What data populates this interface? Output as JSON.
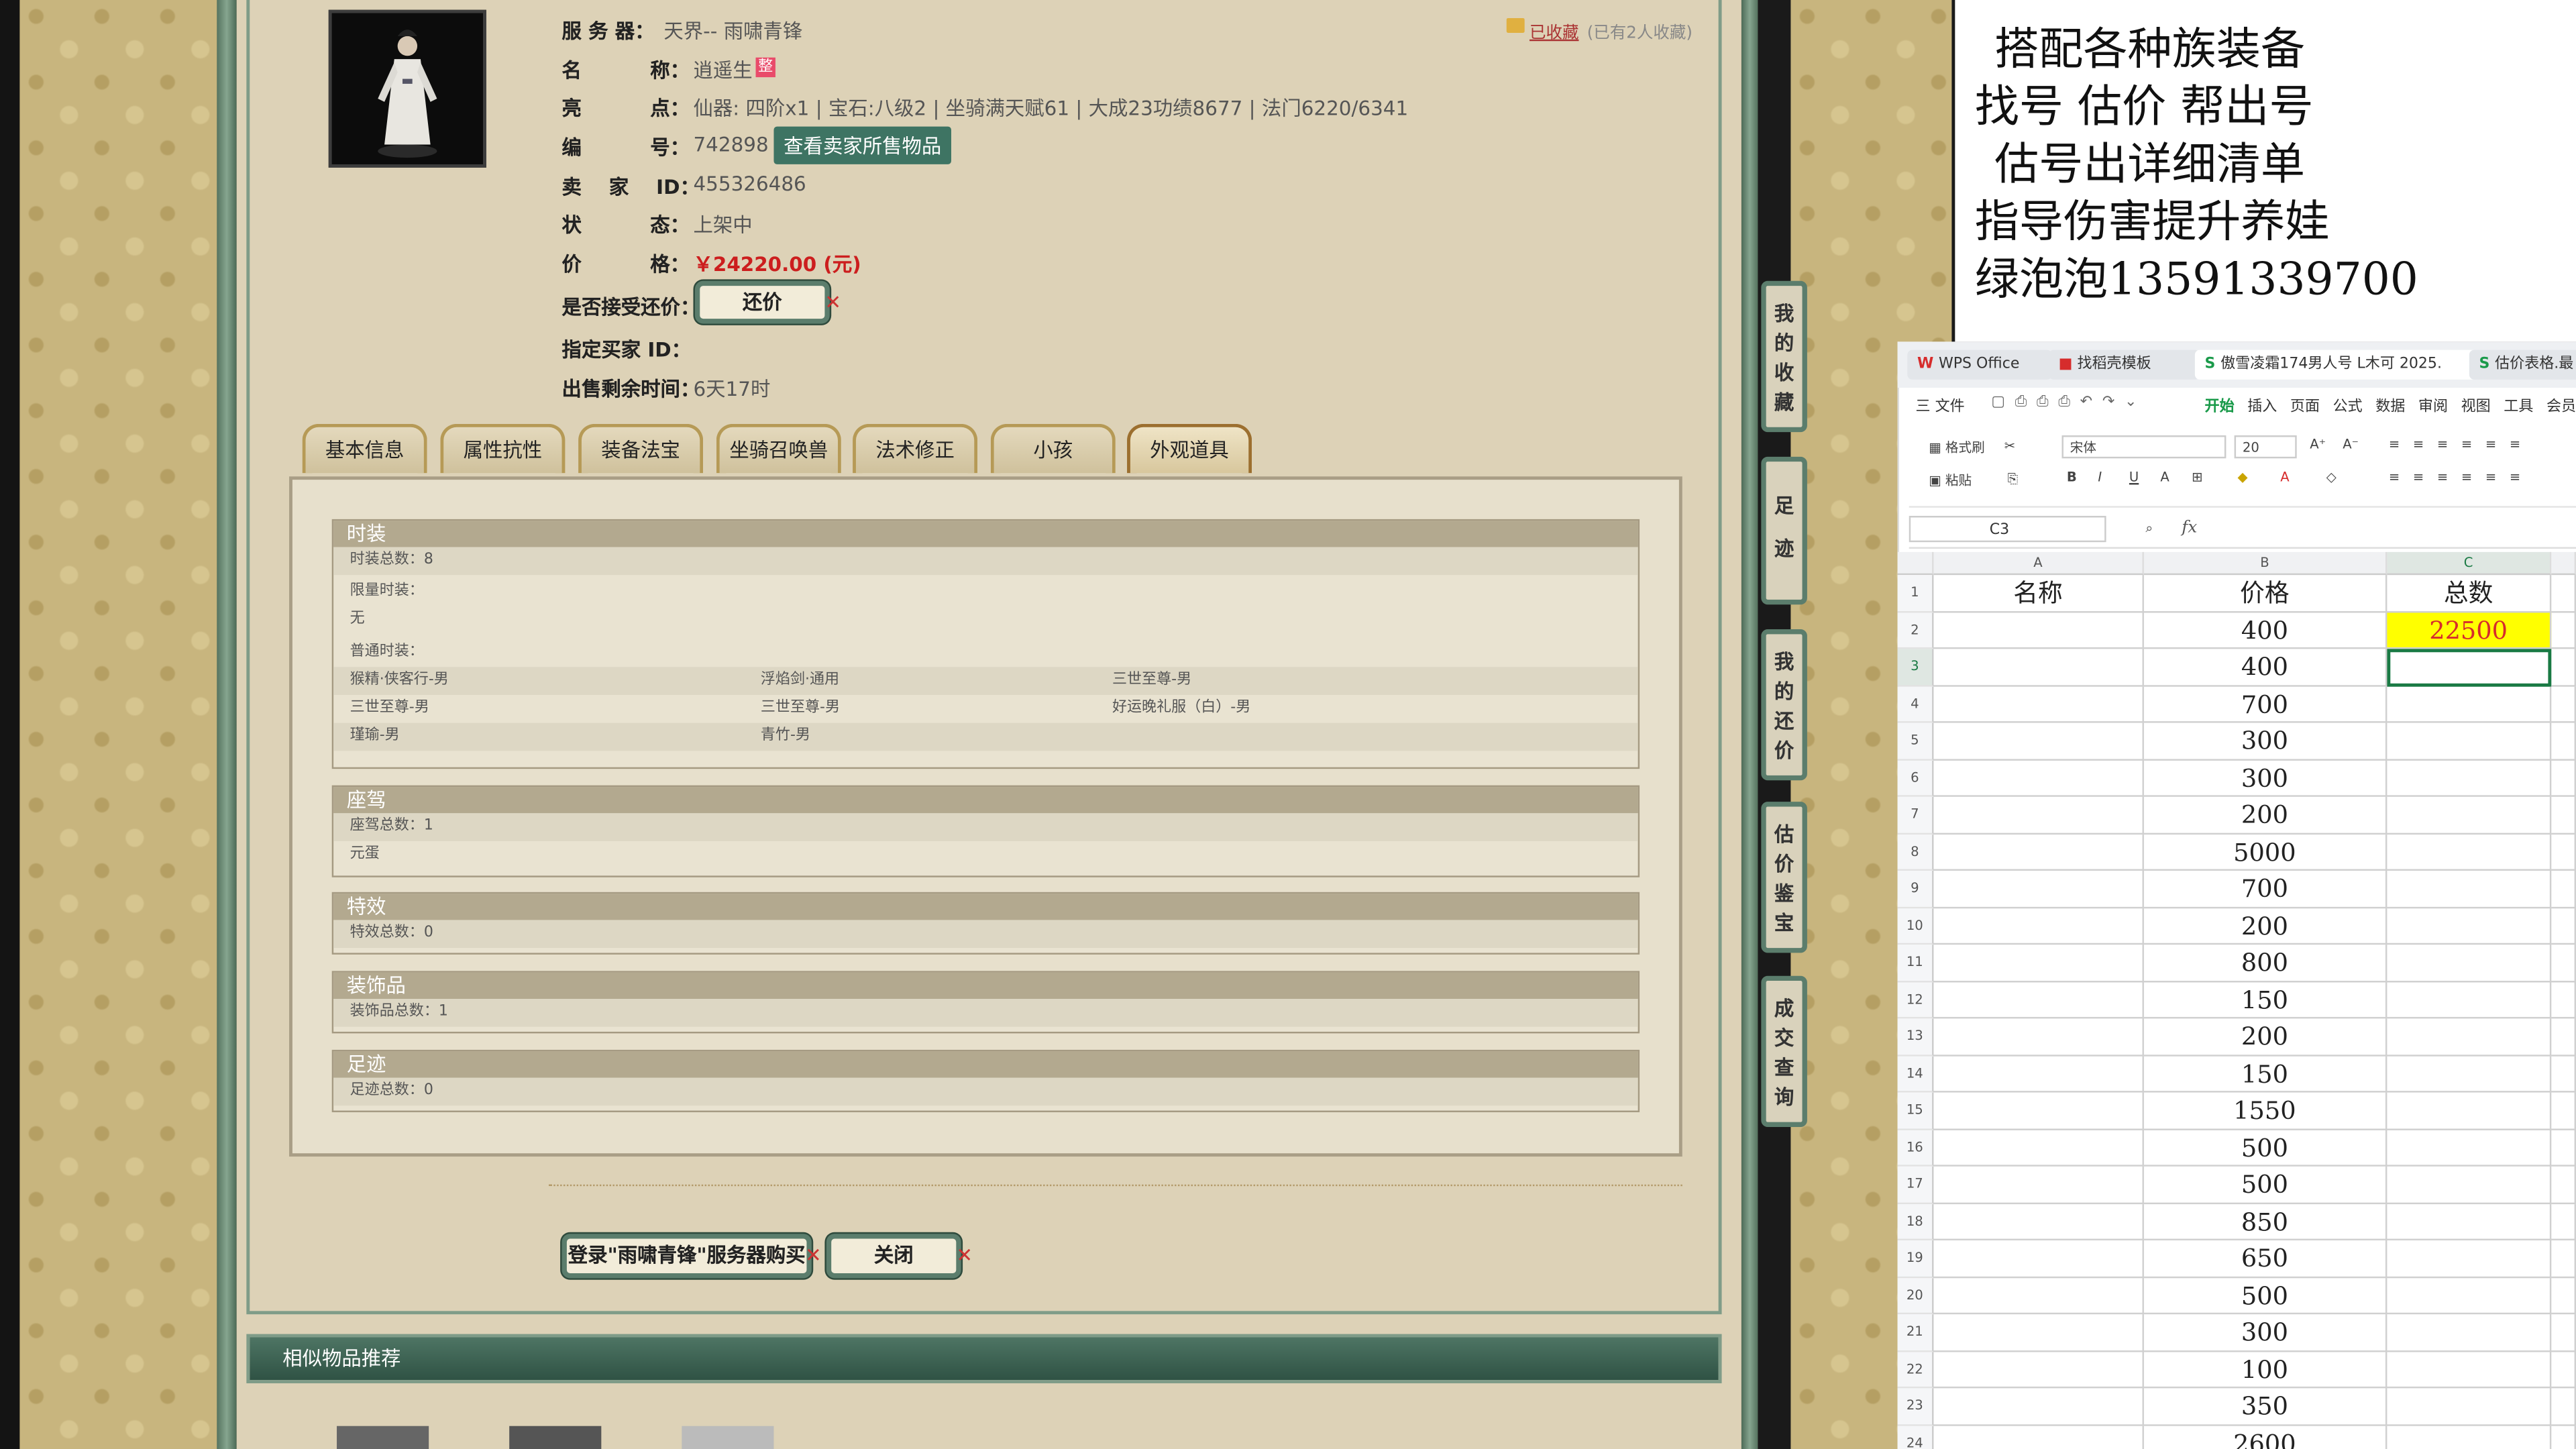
{
  "item": {
    "server_label": "服 务 器：",
    "server_value": "天界-- 雨啸青锋",
    "name_label": "名          称：",
    "name_value": "逍遥生",
    "name_badge": "整",
    "highlights_label": "亮          点：",
    "highlights_value": "仙器: 四阶x1 | 宝石:八级2 | 坐骑满天赋61 | 大成23功绩8677 | 法门6220/6341",
    "id_label": "编          号：",
    "id_value": "742898",
    "view_seller_button": "查看卖家所售物品",
    "seller_label": "卖    家    ID：",
    "seller_value": "455326486",
    "status_label": "状          态：",
    "status_value": "上架中",
    "price_label": "价          格：",
    "price_value": "￥24220.00 (元)",
    "accept_offer_label": "是否接受还价：",
    "offer_button": "还价",
    "buyer_label": "指定买家 ID：",
    "remaining_label": "出售剩余时间：",
    "remaining_value": "6天17时",
    "favorited_text": "已收藏",
    "favorited_count_text": "(已有2人收藏)"
  },
  "tabs": [
    {
      "label": "基本信息",
      "active": false
    },
    {
      "label": "属性抗性",
      "active": false
    },
    {
      "label": "装备法宝",
      "active": false
    },
    {
      "label": "坐骑召唤兽",
      "active": false
    },
    {
      "label": "法术修正",
      "active": false
    },
    {
      "label": "小孩",
      "active": false
    },
    {
      "label": "外观道具",
      "active": true
    }
  ],
  "sections": {
    "fashion": {
      "title": "时装",
      "total": "时装总数：8",
      "limited_label": "限量时装：",
      "limited_value": "无",
      "normal_label": "普通时装：",
      "rows": [
        [
          "猴精·侠客行-男",
          "浮焰剑·通用",
          "三世至尊-男"
        ],
        [
          "三世至尊-男",
          "三世至尊-男",
          "好运晚礼服（白）-男"
        ],
        [
          "瑾瑜-男",
          "青竹-男",
          ""
        ]
      ]
    },
    "mount": {
      "title": "座驾",
      "total": "座驾总数：1",
      "item": "元蛋"
    },
    "effect": {
      "title": "特效",
      "total": "特效总数：0"
    },
    "decoration": {
      "title": "装饰品",
      "total": "装饰品总数：1"
    },
    "footprint": {
      "title": "足迹",
      "total": "足迹总数：0"
    }
  },
  "actions": {
    "login_buy": "登录\"雨啸青锋\"服务器购买",
    "close": "关闭"
  },
  "similar_title": "相似物品推荐",
  "side_nav": [
    "我的收藏",
    "足迹",
    "我的还价",
    "估价鉴宝",
    "成交查询"
  ],
  "ad": {
    "lines": [
      "搭配各种族装备",
      "找号  估价  帮出号",
      "估号出详细清单",
      "指导伤害提升养娃",
      "绿泡泡13591339700"
    ]
  },
  "wps": {
    "tabs": [
      "WPS Office",
      "找稻壳模板",
      "傲雪凌霜174男人号 L木可 2025.",
      "估价表格.最"
    ],
    "menu": [
      "三 文件",
      "开始",
      "插入",
      "页面",
      "公式",
      "数据",
      "审阅",
      "视图",
      "工具",
      "会员"
    ],
    "font_name": "宋体",
    "font_size": "20",
    "format_painter": "格式刷",
    "paste": "粘贴",
    "cell_ref": "C3",
    "fx": "fx",
    "columns": [
      "A",
      "B",
      "C"
    ],
    "headers": [
      "名称",
      "价格",
      "总数"
    ],
    "total": "22500",
    "prices": [
      "400",
      "400",
      "700",
      "300",
      "300",
      "200",
      "5000",
      "700",
      "200",
      "800",
      "150",
      "200",
      "150",
      "1550",
      "500",
      "500",
      "850",
      "650",
      "500",
      "300",
      "100",
      "350",
      "2600"
    ],
    "row_numbers": [
      "1",
      "2",
      "3",
      "4",
      "5",
      "6",
      "7",
      "8",
      "9",
      "10",
      "11",
      "12",
      "13",
      "14",
      "15",
      "16",
      "17",
      "18",
      "19",
      "20",
      "21",
      "22",
      "23",
      "24"
    ]
  },
  "colors": {
    "price_red": "#cc1e1e",
    "accent_green": "#3e7463",
    "total_yellow": "#ffff00"
  }
}
